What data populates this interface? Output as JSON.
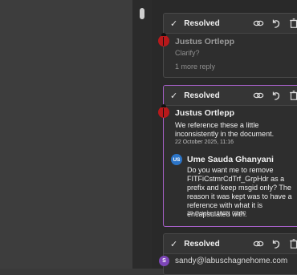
{
  "threads": [
    {
      "status": "Resolved",
      "comments": [
        {
          "author": "Justus Ortlepp",
          "text": "Clarify?"
        }
      ],
      "more_replies": "1 more reply"
    },
    {
      "status": "Resolved",
      "comments": [
        {
          "author": "Justus Ortlepp",
          "text": "We reference these a little inconsistently in the document.",
          "date": "22 October 2025, 11:16"
        },
        {
          "author": "Ume Sauda Ghanyani",
          "initials": "US",
          "text": "Do you want me to remove FITFiCstmrCdTrf_GrpHdr as a prefix and keep msgid only? The reason it was kept was to have a reference with what it is encapsulated with.",
          "date": "29 October 2025, 08:30"
        }
      ]
    },
    {
      "status": "Resolved",
      "next_author": {
        "initials": "S",
        "email": "sandy@labuschagnehome.com"
      }
    }
  ],
  "icons": {
    "check": "checkmark-icon",
    "link": "link-icon",
    "reopen": "undo-icon",
    "delete": "trash-icon"
  },
  "colors": {
    "active_border": "#a660c8",
    "us_avatar": "#2b74c7",
    "s_avatar": "#7d46b8",
    "bug_avatar": "#b8191b"
  }
}
